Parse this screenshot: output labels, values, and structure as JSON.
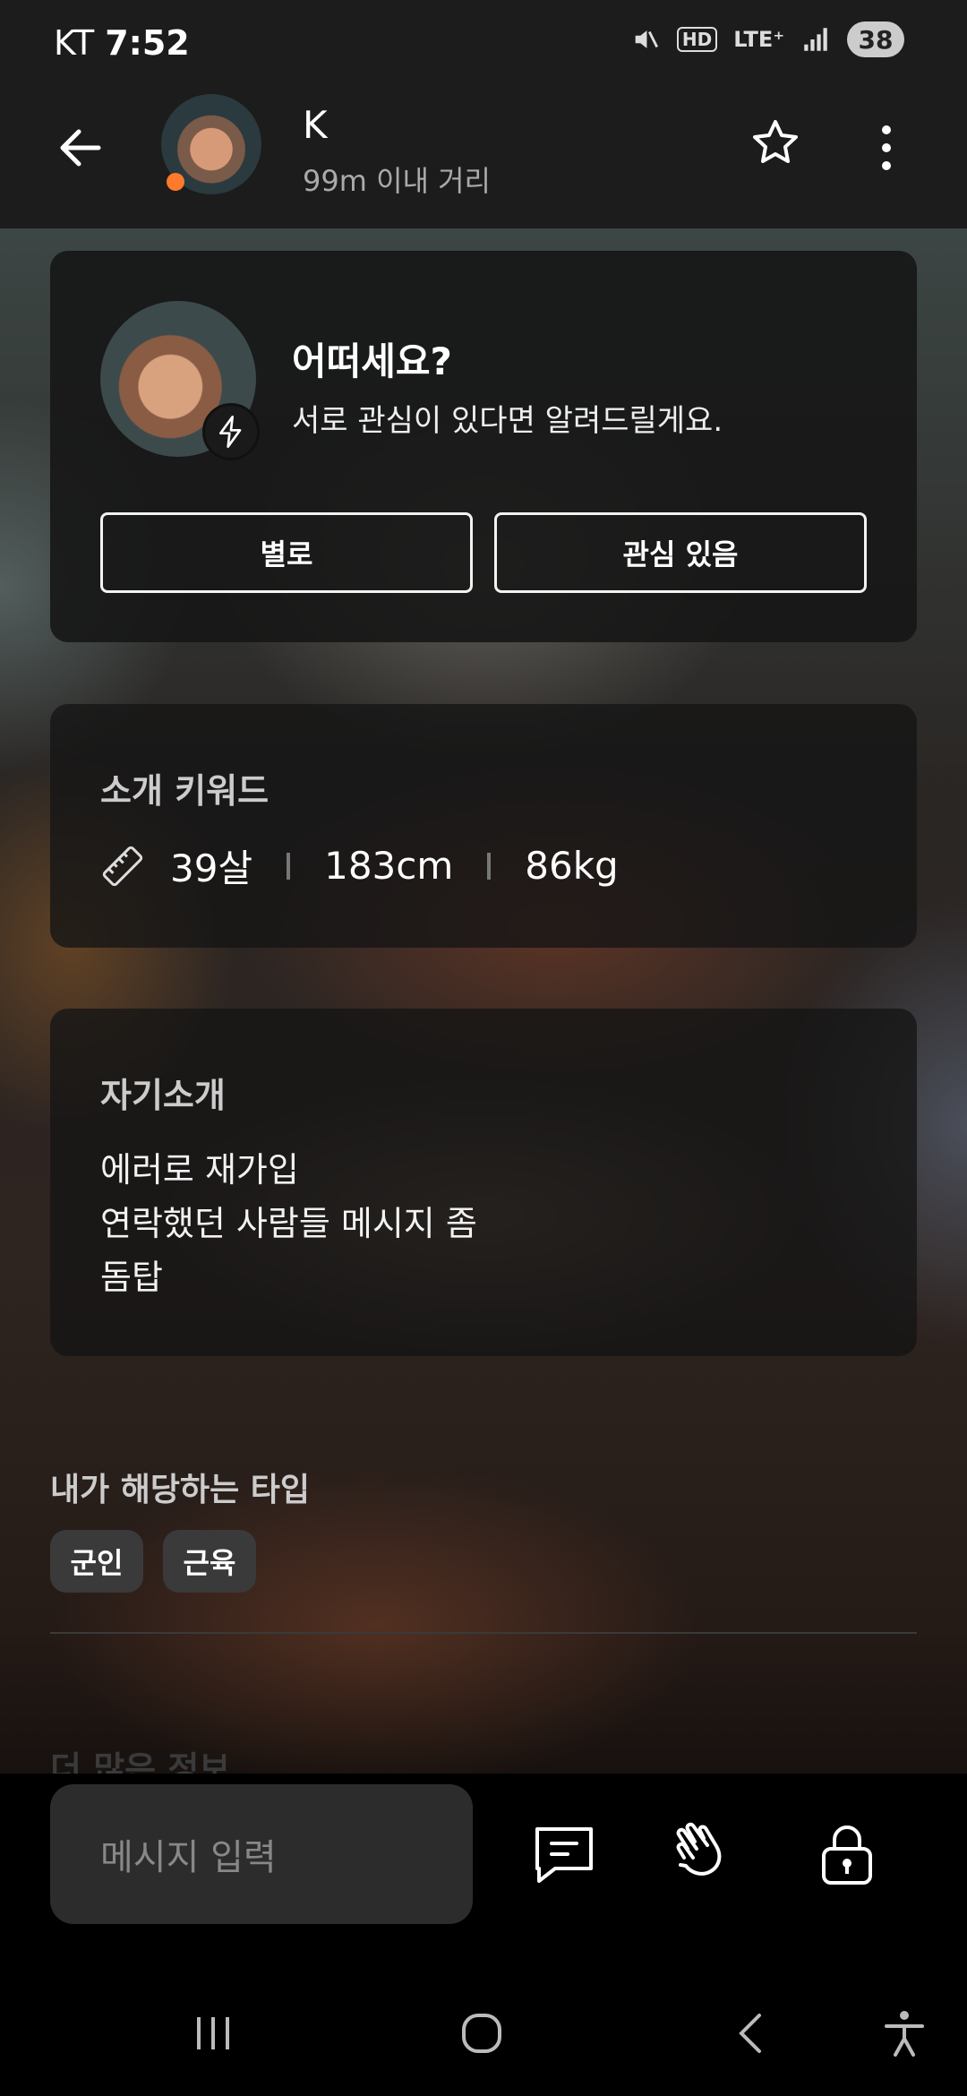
{
  "status_bar": {
    "carrier": "KT",
    "time": "7:52",
    "battery": "38",
    "icons": [
      "mute-icon",
      "hd-icon",
      "lte-icon",
      "signal-icon"
    ],
    "hd_label": "HD",
    "lte_label": "LTE⁺"
  },
  "header": {
    "name": "K",
    "distance": "99m 이내 거리"
  },
  "prompt_card": {
    "title": "어떠세요?",
    "subtitle": "서로 관심이 있다면 알려드릴게요.",
    "no_label": "별로",
    "yes_label": "관심 있음"
  },
  "keywords": {
    "title": "소개 키워드",
    "age": "39살",
    "height": "183cm",
    "weight": "86kg"
  },
  "intro": {
    "title": "자기소개",
    "lines": [
      "에러로 재가입",
      "연락했던 사람들 메시지 좀",
      "돔탑"
    ]
  },
  "types": {
    "title": "내가 해당하는 타입",
    "tags": [
      "군인",
      "근육"
    ]
  },
  "more_info": "더 많은 정보",
  "composer": {
    "placeholder": "메시지 입력"
  },
  "colors": {
    "online": "#ff7a2a",
    "bar_bg": "#1c1c1c"
  }
}
